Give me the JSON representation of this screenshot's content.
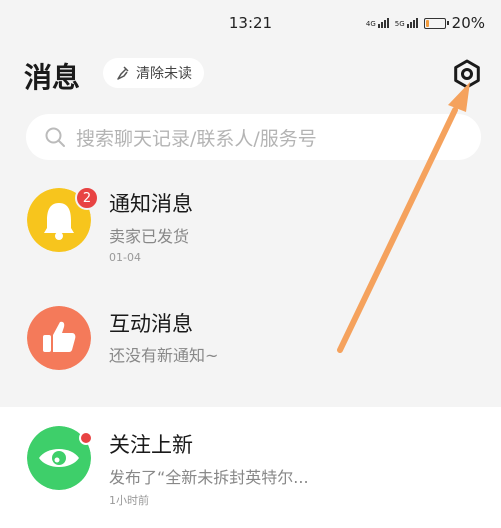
{
  "status_bar": {
    "time": "13:21",
    "net1": "4G",
    "net2": "5G",
    "battery_text": "20%",
    "battery_level": 0.2
  },
  "header": {
    "title": "消息",
    "clear_unread": "清除未读"
  },
  "search": {
    "placeholder": "搜索聊天记录/联系人/服务号"
  },
  "messages": [
    {
      "title": "通知消息",
      "subtitle": "卖家已发货",
      "time": "01-04",
      "badge": "2",
      "color": "#f7c51d"
    },
    {
      "title": "互动消息",
      "subtitle": "还没有新通知~",
      "color": "#f47a5a"
    },
    {
      "title": "关注上新",
      "subtitle": "发布了“全新未拆封英特尔...",
      "time": "1小时前",
      "color": "#3ecf6a"
    }
  ],
  "colors": {
    "accent_arrow": "#f5a25d",
    "badge": "#e84343"
  }
}
